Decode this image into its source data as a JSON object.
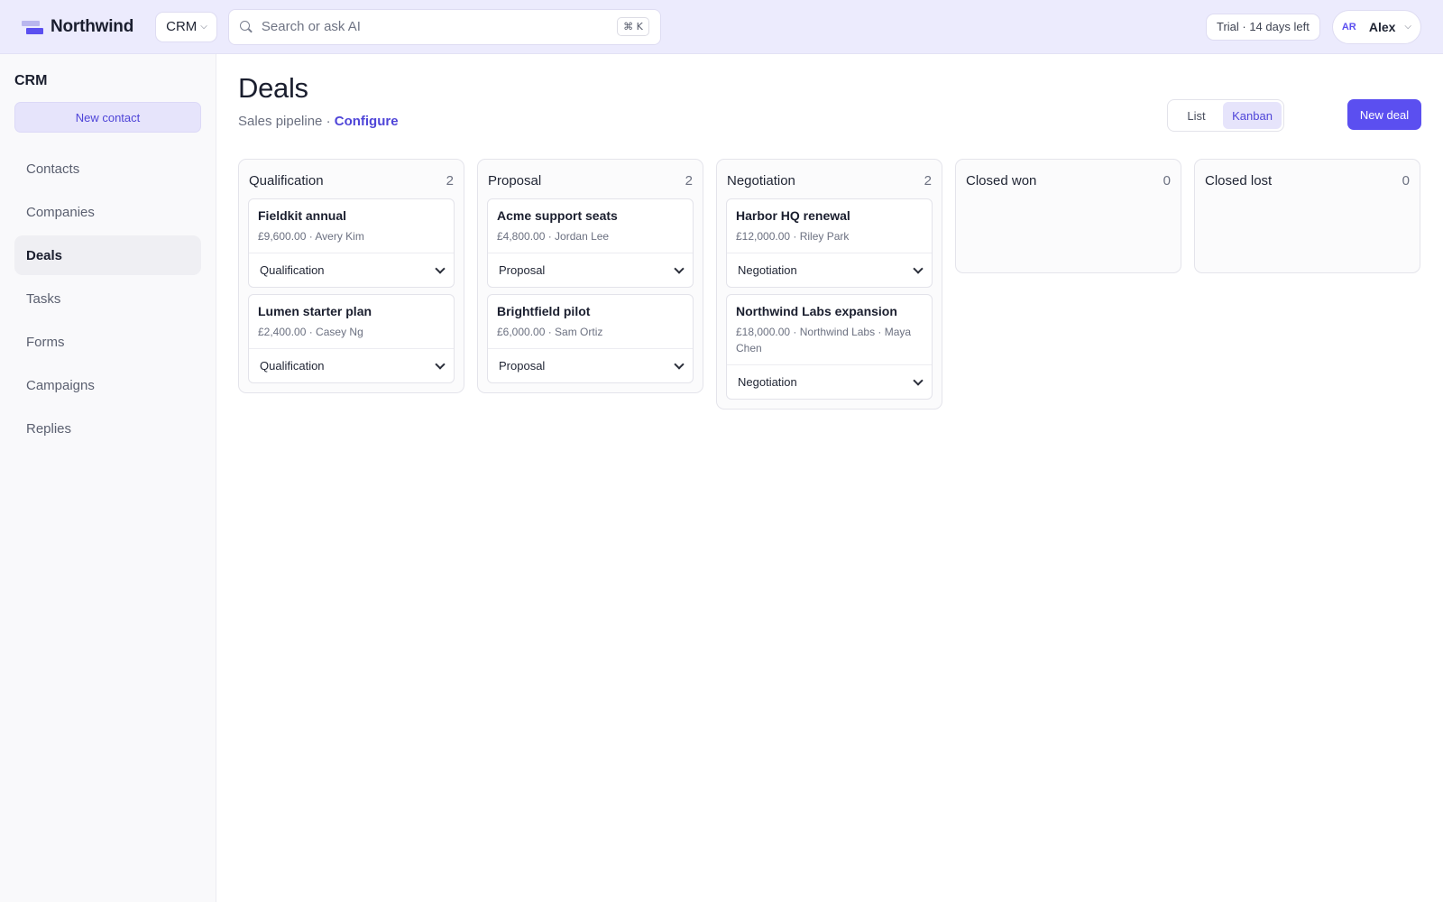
{
  "header": {
    "brand": "Northwind",
    "app_switcher": "CRM",
    "search_placeholder": "Search or ask AI",
    "shortcut": "⌘ K",
    "trial": "Trial · 14 days left",
    "user_initials": "AR",
    "user_name": "Alex"
  },
  "sidebar": {
    "title": "CRM",
    "new_contact": "New contact",
    "items": [
      {
        "label": "Contacts"
      },
      {
        "label": "Companies"
      },
      {
        "label": "Deals"
      },
      {
        "label": "Tasks"
      },
      {
        "label": "Forms"
      },
      {
        "label": "Campaigns"
      },
      {
        "label": "Replies"
      }
    ],
    "active_item": "Deals"
  },
  "main": {
    "title": "Deals",
    "subtitle": "Sales pipeline ·",
    "configure": "Configure",
    "view_list": "List",
    "view_kanban": "Kanban",
    "active_view": "Kanban",
    "new_deal": "New deal"
  },
  "colors": {
    "accent": "#5b4ff0",
    "topbar_bg": "#ecebfd"
  },
  "board": {
    "columns": [
      {
        "name": "Qualification",
        "count": "2",
        "cards": [
          {
            "title": "Fieldkit annual",
            "meta": "£9,600.00 · Avery Kim",
            "stage": "Qualification"
          },
          {
            "title": "Lumen starter plan",
            "meta": "£2,400.00 · Casey Ng",
            "stage": "Qualification"
          }
        ]
      },
      {
        "name": "Proposal",
        "count": "2",
        "cards": [
          {
            "title": "Acme support seats",
            "meta": "£4,800.00 · Jordan Lee",
            "stage": "Proposal"
          },
          {
            "title": "Brightfield pilot",
            "meta": "£6,000.00 · Sam Ortiz",
            "stage": "Proposal"
          }
        ]
      },
      {
        "name": "Negotiation",
        "count": "2",
        "cards": [
          {
            "title": "Harbor HQ renewal",
            "meta": "£12,000.00 · Riley Park",
            "stage": "Negotiation"
          },
          {
            "title": "Northwind Labs expansion",
            "meta": "£18,000.00 · Northwind Labs · Maya Chen",
            "stage": "Negotiation"
          }
        ]
      },
      {
        "name": "Closed won",
        "count": "0",
        "cards": []
      },
      {
        "name": "Closed lost",
        "count": "0",
        "cards": []
      }
    ]
  }
}
